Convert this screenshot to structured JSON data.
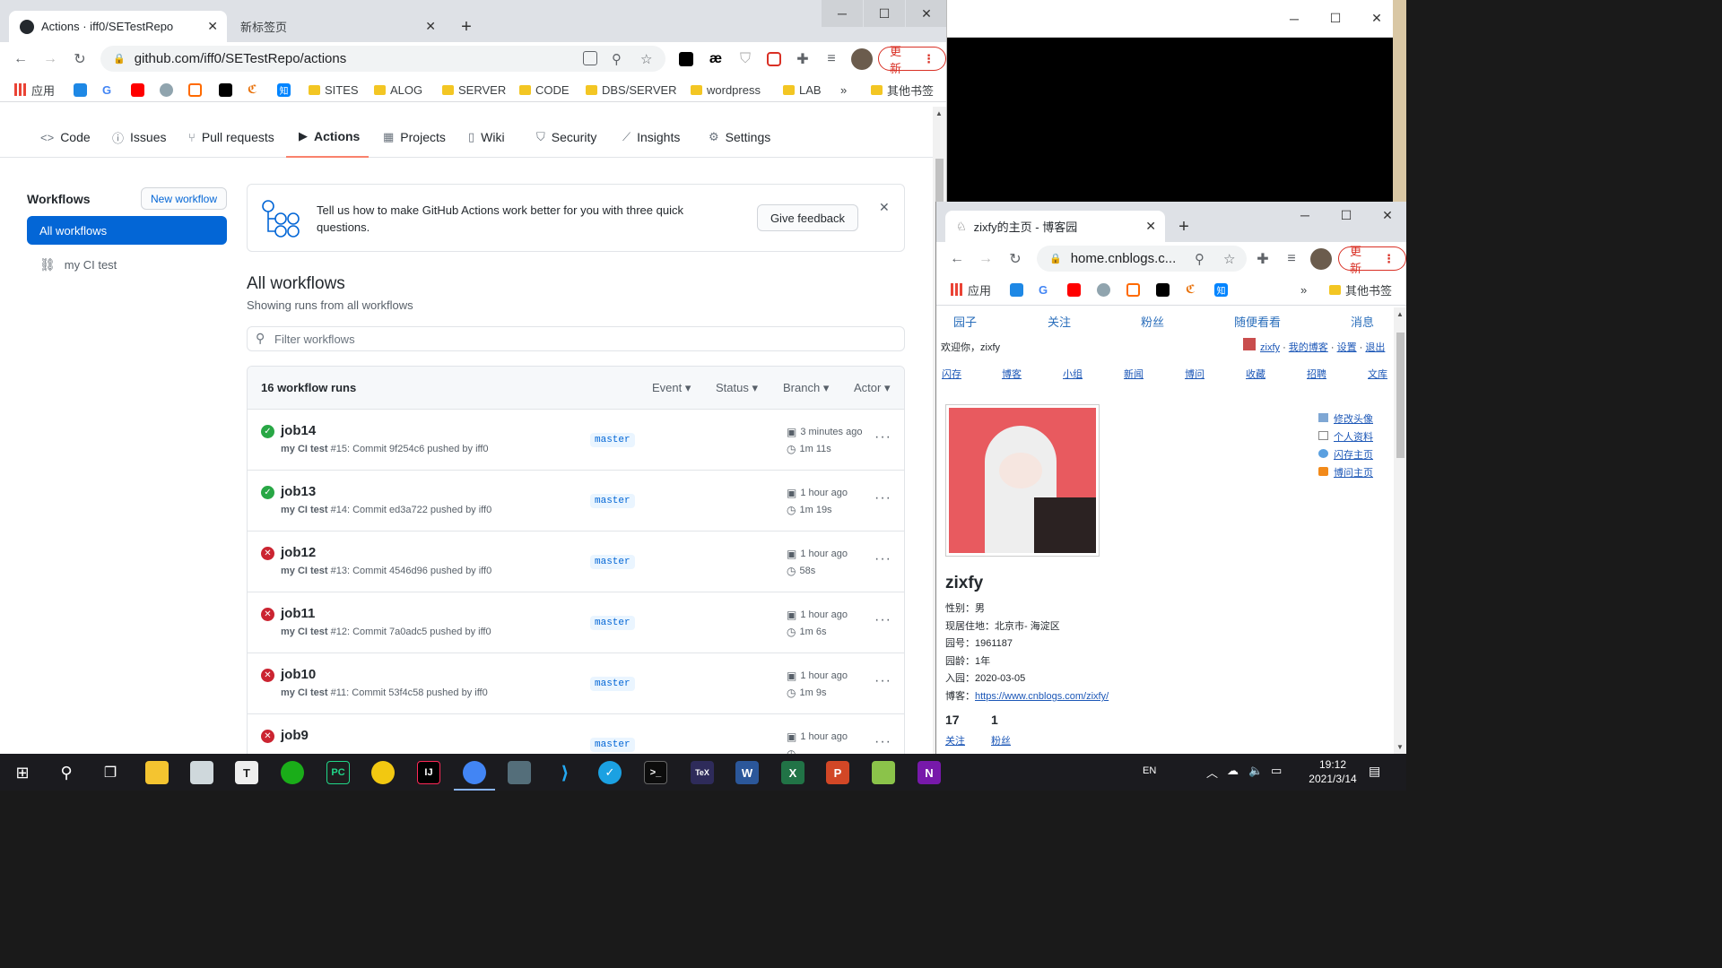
{
  "main_window": {
    "tabs": [
      {
        "title": "Actions · iff0/SETestRepo",
        "active": true
      },
      {
        "title": "新标签页",
        "active": false
      }
    ],
    "url": "github.com/iff0/SETestRepo/actions",
    "update_label": "更新",
    "bookmarks": [
      {
        "label": "应用"
      },
      {
        "label": "SITES"
      },
      {
        "label": "ALOG"
      },
      {
        "label": "SERVER"
      },
      {
        "label": "CODE"
      },
      {
        "label": "DBS/SERVER"
      },
      {
        "label": "wordpress"
      },
      {
        "label": "LAB"
      },
      {
        "label": "»"
      },
      {
        "label": "其他书签"
      }
    ]
  },
  "repo_nav": {
    "items": [
      {
        "label": "Code",
        "icon": "code-icon"
      },
      {
        "label": "Issues",
        "icon": "issue-icon"
      },
      {
        "label": "Pull requests",
        "icon": "pull-request-icon"
      },
      {
        "label": "Actions",
        "icon": "play-icon",
        "selected": true
      },
      {
        "label": "Projects",
        "icon": "project-icon"
      },
      {
        "label": "Wiki",
        "icon": "book-icon"
      },
      {
        "label": "Security",
        "icon": "shield-icon"
      },
      {
        "label": "Insights",
        "icon": "graph-icon"
      },
      {
        "label": "Settings",
        "icon": "gear-icon"
      }
    ]
  },
  "sidebar": {
    "title": "Workflows",
    "new_workflow": "New workflow",
    "all_workflows": "All workflows",
    "workflows": [
      {
        "name": "my CI test"
      }
    ]
  },
  "feedback": {
    "text": "Tell us how to make GitHub Actions work better for you with three quick questions.",
    "button": "Give feedback"
  },
  "main": {
    "title": "All workflows",
    "subtitle": "Showing runs from all workflows",
    "filter_placeholder": "Filter workflows",
    "runs_count": "16 workflow runs",
    "filters": [
      "Event",
      "Status",
      "Branch",
      "Actor"
    ],
    "runs": [
      {
        "name": "job14",
        "status": "success",
        "workflow": "my CI test",
        "meta": " #15: Commit 9f254c6 pushed by iff0",
        "branch": "master",
        "when": "3 minutes ago",
        "duration": "1m 11s"
      },
      {
        "name": "job13",
        "status": "success",
        "workflow": "my CI test",
        "meta": " #14: Commit ed3a722 pushed by iff0",
        "branch": "master",
        "when": "1 hour ago",
        "duration": "1m 19s"
      },
      {
        "name": "job12",
        "status": "failure",
        "workflow": "my CI test",
        "meta": " #13: Commit 4546d96 pushed by iff0",
        "branch": "master",
        "when": "1 hour ago",
        "duration": "58s"
      },
      {
        "name": "job11",
        "status": "failure",
        "workflow": "my CI test",
        "meta": " #12: Commit 7a0adc5 pushed by iff0",
        "branch": "master",
        "when": "1 hour ago",
        "duration": "1m 6s"
      },
      {
        "name": "job10",
        "status": "failure",
        "workflow": "my CI test",
        "meta": " #11: Commit 53f4c58 pushed by iff0",
        "branch": "master",
        "when": "1 hour ago",
        "duration": "1m 9s"
      },
      {
        "name": "job9",
        "status": "failure",
        "workflow": "",
        "meta": "",
        "branch": "master",
        "when": "1 hour ago",
        "duration": ""
      }
    ]
  },
  "second_window": {
    "tab_title": "zixfy的主页 - 博客园",
    "url": "home.cnblogs.c...",
    "update_label": "更新",
    "bookmarks": [
      {
        "label": "应用"
      },
      {
        "label": "»"
      },
      {
        "label": "其他书签"
      }
    ],
    "top_nav": [
      "园子",
      "关注",
      "粉丝",
      "随便看看",
      "消息"
    ],
    "welcome": "欢迎你，zixfy",
    "user_links": {
      "user": "zixfy",
      "my_blog": "我的博客",
      "settings": "设置",
      "logout": "退出",
      "sep": "·"
    },
    "sub_nav": [
      "闪存",
      "博客",
      "小组",
      "新闻",
      "博问",
      "收藏",
      "招聘",
      "文库"
    ],
    "side_links": [
      "修改头像",
      "个人资料",
      "闪存主页",
      "博问主页"
    ],
    "profile": {
      "name": "zixfy",
      "fields": [
        {
          "label": "性别：",
          "value": "男"
        },
        {
          "label": "现居住地：",
          "value": "北京市- 海淀区"
        },
        {
          "label": "园号：",
          "value": "1961187"
        },
        {
          "label": "园龄：",
          "value": "1年"
        },
        {
          "label": "入园：",
          "value": "2020-03-05"
        },
        {
          "label": "博客：",
          "value": "https://www.cnblogs.com/zixfy/"
        }
      ],
      "following_count": "17",
      "following_label": "关注",
      "followers_count": "1",
      "followers_label": "粉丝"
    }
  },
  "taskbar": {
    "lang": "EN",
    "time": "19:12",
    "date": "2021/3/14"
  },
  "colors": {
    "github_blue": "#0366d6",
    "success": "#28a745",
    "failure": "#cb2431",
    "taskbar": "#1b1b1f"
  }
}
